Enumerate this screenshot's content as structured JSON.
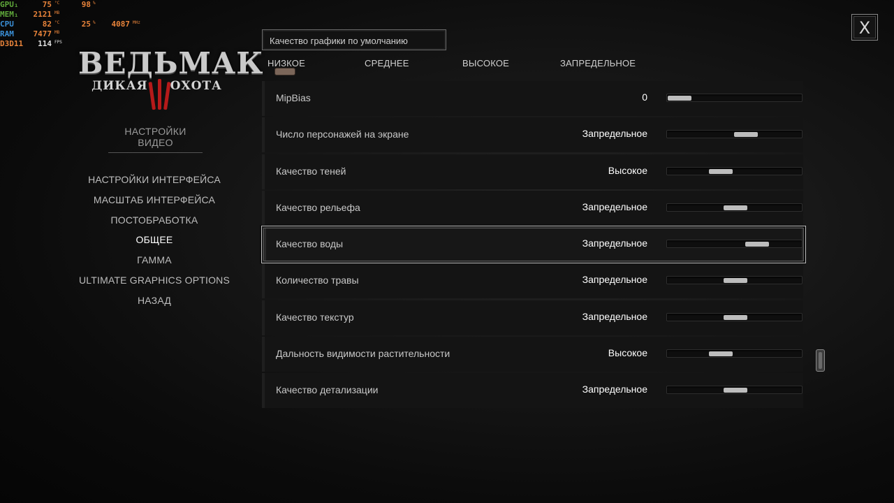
{
  "overlay": {
    "rows": [
      {
        "label": "GPU₁",
        "label_color": "#5fa83a",
        "v1": "75",
        "u1": "°C",
        "v2": "98",
        "u2": "%",
        "v3": "",
        "u3": ""
      },
      {
        "label": "MEM₁",
        "label_color": "#5fa83a",
        "v1": "2121",
        "u1": "MB",
        "v2": "",
        "u2": "",
        "v3": "",
        "u3": ""
      },
      {
        "label": "CPU",
        "label_color": "#3a8fd6",
        "v1": "82",
        "u1": "°C",
        "v2": "25",
        "u2": "%",
        "v3": "4087",
        "u3": "MHz"
      },
      {
        "label": "RAM",
        "label_color": "#3a8fd6",
        "v1": "7477",
        "u1": "MB",
        "v2": "",
        "u2": "",
        "v3": "",
        "u3": ""
      },
      {
        "label": "D3D11",
        "label_color": "#e8833a",
        "v1": "114",
        "u1": "FPS",
        "v2": "",
        "u2": "",
        "v3": "",
        "u3": ""
      }
    ]
  },
  "logo": {
    "title": "ВЕДЬМАК",
    "sub_left": "ДИКАЯ",
    "sub_right": "ОХОТА"
  },
  "menu": {
    "title": "НАСТРОЙКИ ВИДЕО",
    "items": [
      {
        "label": "НАСТРОЙКИ ИНТЕРФЕЙСА"
      },
      {
        "label": "МАСШТАБ ИНТЕРФЕЙСА"
      },
      {
        "label": "ПОСТОБРАБОТКА"
      },
      {
        "label": "ОБЩЕЕ"
      },
      {
        "label": "ГАММА"
      },
      {
        "label": "ULTIMATE GRAPHICS OPTIONS"
      },
      {
        "label": "НАЗАД"
      }
    ],
    "active_index": 3
  },
  "preset": {
    "label": "Качество графики по умолчанию",
    "tabs": [
      "НИЗКОЕ",
      "СРЕДНЕЕ",
      "ВЫСОКОЕ",
      "ЗАПРЕДЕЛЬНОЕ"
    ]
  },
  "settings": [
    {
      "label": "MipBias",
      "value": "0",
      "level": 0.0
    },
    {
      "label": "Число персонажей на экране",
      "value": "Запредельное",
      "level": 0.6
    },
    {
      "label": "Качество теней",
      "value": "Высокое",
      "level": 0.37
    },
    {
      "label": "Качество рельефа",
      "value": "Запредельное",
      "level": 0.5
    },
    {
      "label": "Качество воды",
      "value": "Запредельное",
      "level": 0.7
    },
    {
      "label": "Количество травы",
      "value": "Запредельное",
      "level": 0.5
    },
    {
      "label": "Качество текстур",
      "value": "Запредельное",
      "level": 0.5
    },
    {
      "label": "Дальность видимости растительности",
      "value": "Высокое",
      "level": 0.37
    },
    {
      "label": "Качество детализации",
      "value": "Запредельное",
      "level": 0.5
    }
  ],
  "selected_setting_index": 4,
  "close": {
    "label": "X"
  }
}
